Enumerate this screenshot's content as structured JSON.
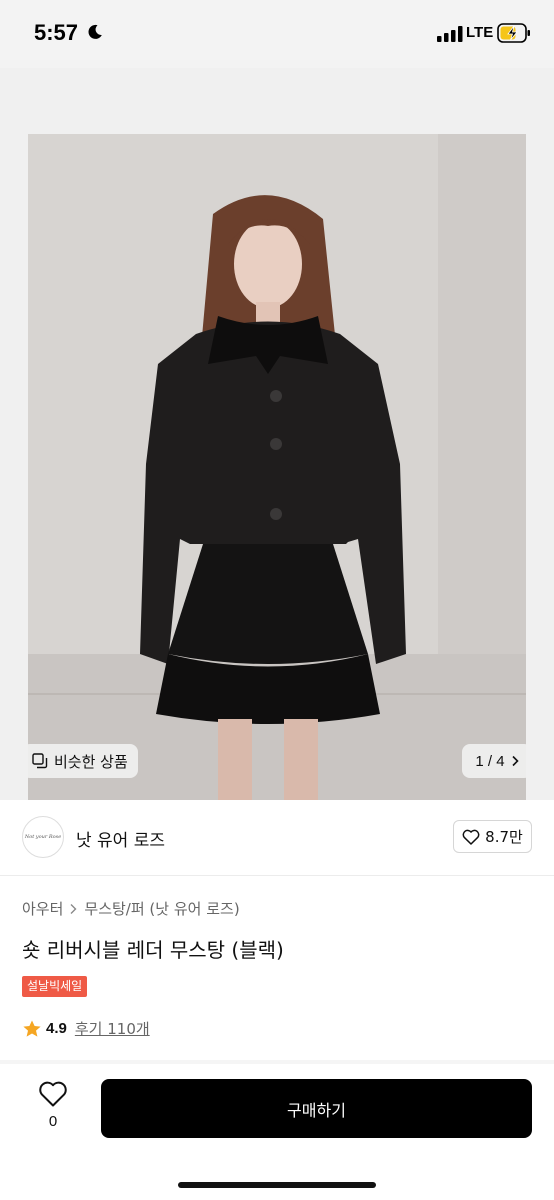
{
  "status_bar": {
    "time": "5:57",
    "network": "LTE",
    "icons": [
      "moon-icon",
      "signal-bars-icon",
      "battery-charging-icon"
    ]
  },
  "gallery": {
    "similar_button_label": "비슷한 상품",
    "page_counter": "1 / 4",
    "current_page": 1,
    "total_pages": 4
  },
  "brand": {
    "name": "낫 유어 로즈",
    "logo_text": "Not your Rose",
    "like_count": "8.7만"
  },
  "product": {
    "breadcrumb": [
      "아우터",
      "무스탕/퍼 (낫 유어 로즈)"
    ],
    "title": "숏 리버시블 레더 무스탕 (블랙)",
    "badge": "설날빅세일",
    "rating": "4.9",
    "reviews": "후기 110개"
  },
  "bottom_bar": {
    "wish_count": "0",
    "buy_label": "구매하기"
  },
  "colors": {
    "accent_badge": "#ef5a46",
    "star": "#f5a623",
    "buy_button": "#000000"
  }
}
